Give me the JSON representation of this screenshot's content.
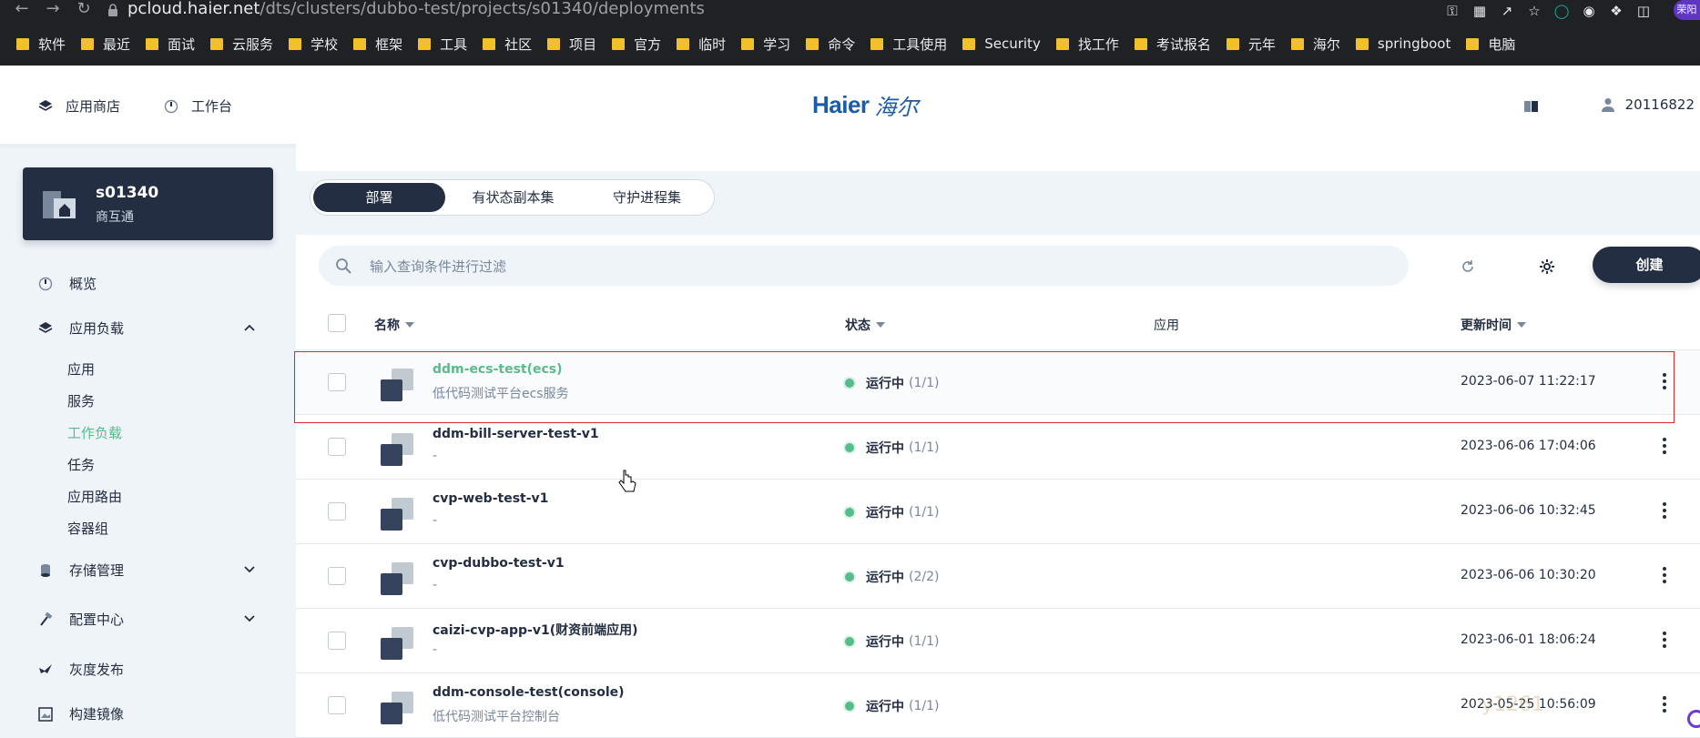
{
  "browser": {
    "url_host": "pcloud.haier.net",
    "url_path": "/dts/clusters/dubbo-test/projects/s01340/deployments",
    "profile_label": "荣阳",
    "bookmarks": [
      "软件",
      "最近",
      "面试",
      "云服务",
      "学校",
      "框架",
      "工具",
      "社区",
      "项目",
      "官方",
      "临时",
      "学习",
      "命令",
      "工具使用",
      "Security",
      "找工作",
      "考试报名",
      "元年",
      "海尔",
      "springboot",
      "电脑"
    ]
  },
  "header": {
    "app_store": "应用商店",
    "workbench": "工作台",
    "logo_en": "Haier",
    "logo_cn": "海尔",
    "user_id": "20116822"
  },
  "sidebar": {
    "project_name": "s01340",
    "project_desc": "商互通",
    "overview": "概览",
    "workloads_group": "应用负载",
    "sub_items": [
      "应用",
      "服务",
      "工作负载",
      "任务",
      "应用路由",
      "容器组"
    ],
    "storage": "存储管理",
    "config": "配置中心",
    "gray_release": "灰度发布",
    "build_image": "构建镜像"
  },
  "tabs": [
    "部署",
    "有状态副本集",
    "守护进程集"
  ],
  "toolbar": {
    "search_placeholder": "输入查询条件进行过滤",
    "create_label": "创建"
  },
  "table": {
    "headers": {
      "name": "名称",
      "status": "状态",
      "app": "应用",
      "updated": "更新时间"
    },
    "rows": [
      {
        "name": "ddm-ecs-test(ecs)",
        "desc": "低代码测试平台ecs服务",
        "status": "运行中",
        "count": "(1/1)",
        "updated": "2023-06-07 11:22:17"
      },
      {
        "name": "ddm-bill-server-test-v1",
        "desc": "-",
        "status": "运行中",
        "count": "(1/1)",
        "updated": "2023-06-06 17:04:06"
      },
      {
        "name": "cvp-web-test-v1",
        "desc": "-",
        "status": "运行中",
        "count": "(1/1)",
        "updated": "2023-06-06 10:32:45"
      },
      {
        "name": "cvp-dubbo-test-v1",
        "desc": "-",
        "status": "运行中",
        "count": "(2/2)",
        "updated": "2023-06-06 10:30:20"
      },
      {
        "name": "caizi-cvp-app-v1(财资前端应用)",
        "desc": "-",
        "status": "运行中",
        "count": "(1/1)",
        "updated": "2023-06-01 18:06:24"
      },
      {
        "name": "ddm-console-test(console)",
        "desc": "低代码测试平台控制台",
        "status": "运行中",
        "count": "(1/1)",
        "updated": "2023-05-25 10:56:09"
      }
    ]
  },
  "watermark": "y1261",
  "colors": {
    "dark": "#242e42",
    "accent_green": "#55bc8a",
    "highlight_red": "#e02828",
    "bg": "#eff4f9"
  }
}
